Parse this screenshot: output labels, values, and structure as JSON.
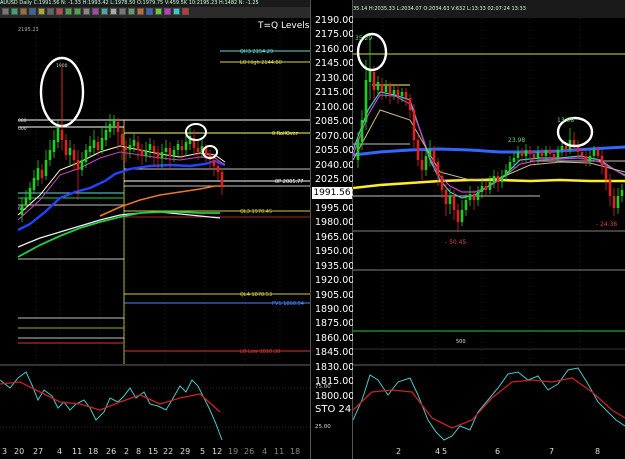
{
  "left_chart": {
    "title_bar": "AUUSD Daily C:1991.56 N: -1.33 H:1993.42 L:1978.50 O:1979.75 V:459.5K 10:2195.23 H:1482 N: -1.25",
    "price_label_top": "2195.23",
    "overlay_title": "T=Q Levels New",
    "left_level_labels": [
      "080",
      "000",
      "60"
    ],
    "level_labels": [
      {
        "text": "QH3 2154.29",
        "color": "#66dddd",
        "price": 2155
      },
      {
        "text": "LO High 2144.80",
        "color": "#d8d84a",
        "price": 2145
      },
      {
        "text": "0 RollOver",
        "color": "#ffff66",
        "price": 2066
      },
      {
        "text": "0P 2005.77",
        "color": "#ffffff",
        "price": 2006
      },
      {
        "text": "QL3 1970.45",
        "color": "#cccc44",
        "price": 1970
      },
      {
        "text": "QL4 1878.53",
        "color": "#cccc44",
        "price": 1878
      },
      {
        "text": "PV1 1868.94",
        "color": "#4488ff",
        "price": 1869
      },
      {
        "text": "LO Low 1810.38",
        "color": "#dd3333",
        "price": 1811
      }
    ],
    "current_price": "1991.56",
    "indicator_label": "STO 24",
    "x_axis_labels": [
      "3",
      "20",
      "27",
      "4",
      "11",
      "18",
      "26",
      "2",
      "8",
      "15",
      "22",
      "29",
      "5",
      "12",
      "19",
      "26",
      "4",
      "11",
      "18"
    ]
  },
  "price_axis": {
    "ticks": [
      "2190.00",
      "2175.00",
      "2160.00",
      "2145.00",
      "2130.00",
      "2115.00",
      "2100.00",
      "2085.00",
      "2070.00",
      "2055.00",
      "2040.00",
      "2025.00",
      "2010.00",
      "1995.00",
      "1980.00",
      "1965.00",
      "1950.00",
      "1935.00",
      "1920.00",
      "1905.00",
      "1890.00",
      "1875.00",
      "1860.00",
      "1845.00",
      "1830.00",
      "1815.00",
      "1800.00"
    ],
    "osc_ticks": [
      "75.00",
      "25.00"
    ]
  },
  "right_chart": {
    "title_bar": "35.14 H:2035.33 L:2034.07 O:2034.63 V:632 L:13:33 02:07:24 13:33",
    "annotations": [
      {
        "text": "35.29",
        "color": "#66dd66"
      },
      {
        "text": "23.98",
        "color": "#66dd66"
      },
      {
        "text": "13.98",
        "color": "#66dd66"
      },
      {
        "text": "- 50.45",
        "color": "#dd4444"
      },
      {
        "text": "- 24.36",
        "color": "#dd4444"
      }
    ],
    "volume_label": "500",
    "x_axis_labels": [
      "2",
      "4",
      "5",
      "6",
      "7",
      "8"
    ]
  },
  "colors": {
    "up_candle": "#22cc22",
    "down_candle": "#dd2222",
    "blue_ma": "#2244ff",
    "green_ma": "#22cc44",
    "orange_ma": "#ee7722",
    "yellow_ma": "#ffee22",
    "osc_cyan": "#44cccc",
    "osc_red": "#cc2222"
  }
}
